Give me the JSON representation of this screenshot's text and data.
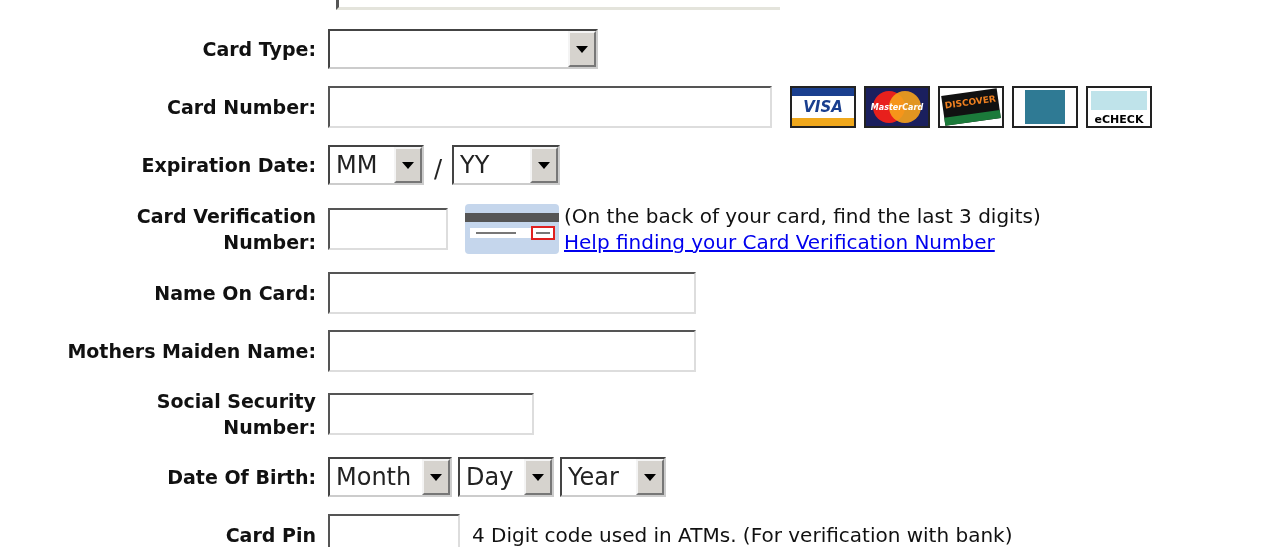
{
  "rows": [
    {
      "kind": "card_type",
      "label": "Card Type:"
    },
    {
      "kind": "card_number",
      "label": "Card Number:",
      "logos": [
        {
          "kind": "visa",
          "label": "VISA"
        },
        {
          "kind": "mastercard",
          "label": "MasterCard"
        },
        {
          "kind": "discover",
          "label": "DISCOVER"
        },
        {
          "kind": "amex"
        },
        {
          "kind": "echeck",
          "label": "eCHECK"
        }
      ]
    },
    {
      "kind": "expiry",
      "label": "Expiration Date:",
      "selects": [
        {
          "value": "MM"
        },
        {
          "value": "YY"
        }
      ],
      "separator": "/"
    },
    {
      "kind": "cvv",
      "label": "Card Verification Number:",
      "note": "(On the back of your card, find the last 3 digits)",
      "link": "Help finding your Card Verification Number"
    },
    {
      "kind": "name",
      "label": "Name On Card:"
    },
    {
      "kind": "name",
      "label": "Mothers Maiden Name:"
    },
    {
      "kind": "ssn",
      "label": "Social Security Number:"
    },
    {
      "kind": "dob",
      "label": "Date Of Birth:",
      "selects": [
        {
          "value": "Month"
        },
        {
          "value": "Day"
        },
        {
          "value": "Year"
        }
      ]
    },
    {
      "kind": "pin",
      "label": "Card Pin",
      "note": "4 Digit code used in ATMs. (For verification with bank)"
    }
  ]
}
